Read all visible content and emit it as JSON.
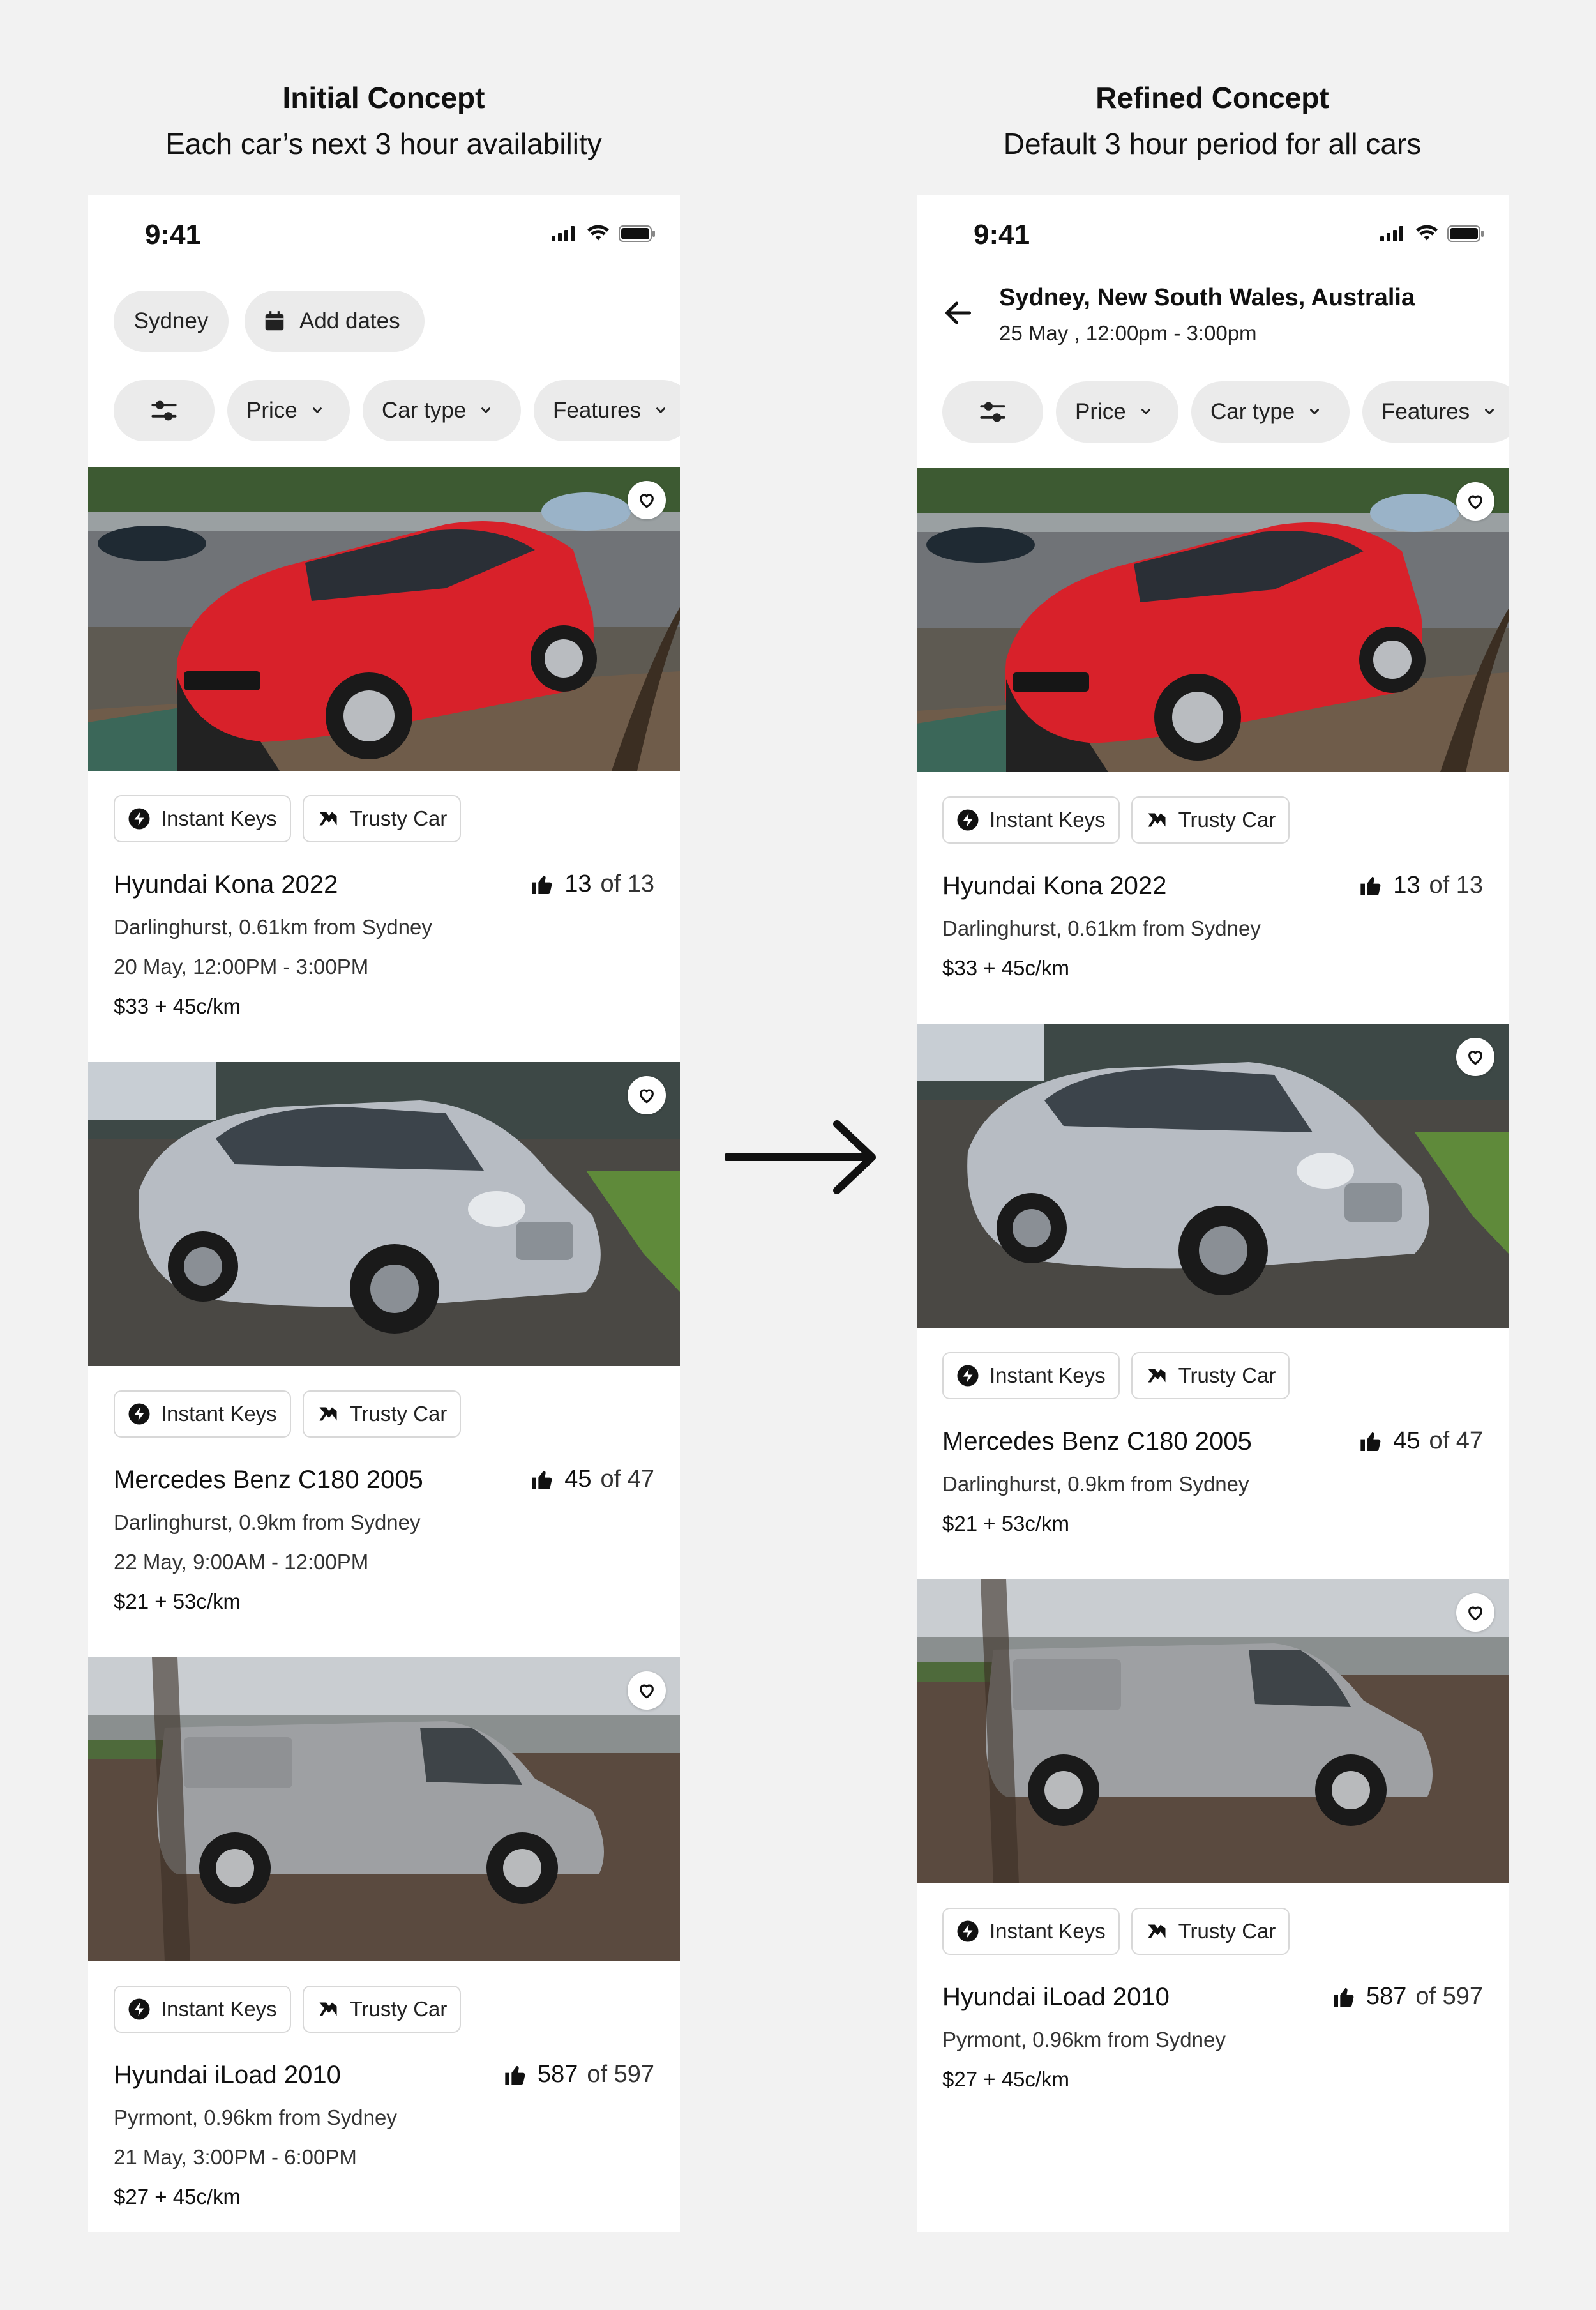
{
  "left_heading": {
    "title": "Initial Concept",
    "subtitle": "Each car’s next 3 hour availability"
  },
  "right_heading": {
    "title": "Refined Concept",
    "subtitle": "Default 3 hour period for all cars"
  },
  "status": {
    "time": "9:41"
  },
  "left_screen": {
    "chips": {
      "location": "Sydney",
      "dates": "Add dates"
    },
    "cars": [
      {
        "name": "Hyundai Kona 2022",
        "rating": "13",
        "rating_of": "of 13",
        "location": "Darlinghurst, 0.61km from Sydney",
        "availability": "20 May, 12:00PM - 3:00PM",
        "price": "$33",
        "plus": "+",
        "rate": "45c/km",
        "color": "red-suv"
      },
      {
        "name": "Mercedes Benz C180 2005",
        "rating": "45",
        "rating_of": "of 47",
        "location": "Darlinghurst, 0.9km from Sydney",
        "availability": "22 May, 9:00AM - 12:00PM",
        "price": "$21",
        "plus": "+",
        "rate": "53c/km",
        "color": "silver-sedan"
      },
      {
        "name": "Hyundai iLoad 2010",
        "rating": "587",
        "rating_of": "of 597",
        "location": "Pyrmont, 0.96km from Sydney",
        "availability": "21 May, 3:00PM - 6:00PM",
        "price": "$27",
        "plus": "+",
        "rate": "45c/km",
        "color": "grey-van"
      }
    ]
  },
  "right_screen": {
    "location_title": "Sydney, New South Wales, Australia",
    "location_sub": "25 May , 12:00pm - 3:00pm",
    "cars": [
      {
        "name": "Hyundai Kona 2022",
        "rating": "13",
        "rating_of": "of 13",
        "location": "Darlinghurst, 0.61km from Sydney",
        "price": "$33",
        "plus": "+",
        "rate": "45c/km"
      },
      {
        "name": "Mercedes Benz C180 2005",
        "rating": "45",
        "rating_of": "of 47",
        "location": "Darlinghurst, 0.9km from Sydney",
        "price": "$21",
        "plus": "+",
        "rate": "53c/km"
      },
      {
        "name": "Hyundai iLoad 2010",
        "rating": "587",
        "rating_of": "of 597",
        "location": "Pyrmont, 0.96km from Sydney",
        "price": "$27",
        "plus": "+",
        "rate": "45c/km"
      }
    ]
  },
  "filters": {
    "price": "Price",
    "car_type": "Car type",
    "features": "Features"
  },
  "badges": {
    "instant_keys": "Instant Keys",
    "trusty_car": "Trusty Car"
  },
  "icons": [
    "signal-icon",
    "wifi-icon",
    "battery-icon",
    "calendar-icon",
    "sliders-icon",
    "chevron-down-icon",
    "heart-icon",
    "lightning-icon",
    "trusty-car-icon",
    "thumbs-up-icon",
    "back-arrow-icon",
    "right-arrow-icon"
  ],
  "colors": {
    "chip_bg": "#ebebeb",
    "page_bg": "#f2f2f2",
    "car_red": "#d8212a",
    "car_silver": "#b7bcc3"
  }
}
